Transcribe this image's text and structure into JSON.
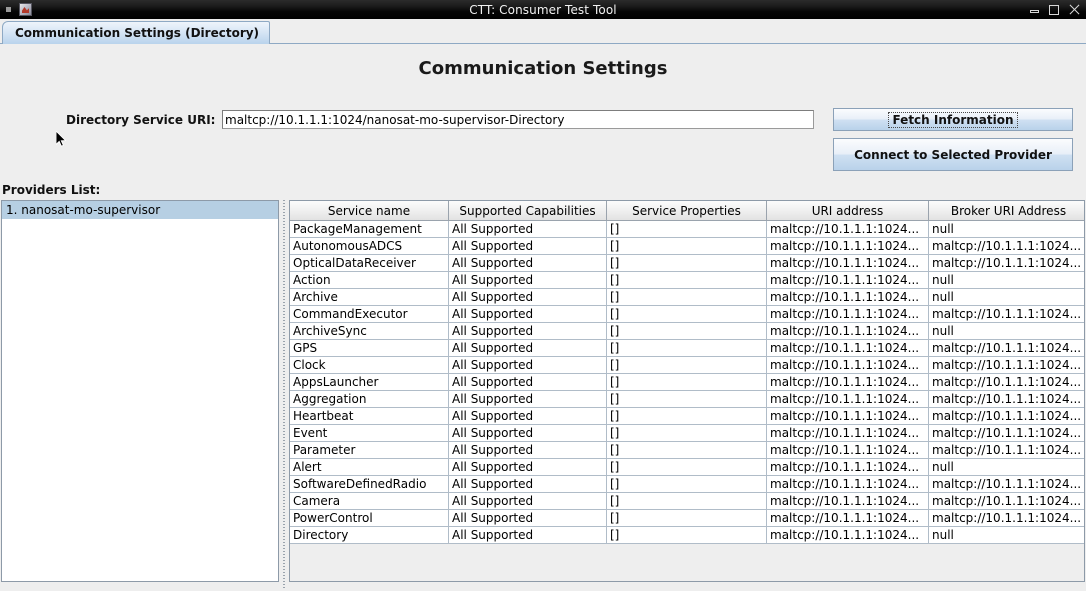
{
  "window": {
    "title": "CTT: Consumer Test Tool",
    "app_icon": "app-image-icon",
    "minimize_label": "Minimize",
    "maximize_label": "Maximize",
    "close_label": "Close"
  },
  "tabs": [
    {
      "label": "Communication Settings (Directory)",
      "selected": true
    }
  ],
  "main": {
    "page_title": "Communication Settings",
    "uri_label": "Directory Service URI:",
    "uri_value": "maltcp://10.1.1.1:1024/nanosat-mo-supervisor-Directory",
    "uri_placeholder": "",
    "fetch_button": "Fetch Information",
    "connect_button": "Connect to Selected Provider",
    "providers_label": "Providers List:"
  },
  "providers": [
    {
      "label": "1. nanosat-mo-supervisor",
      "selected": true
    }
  ],
  "table": {
    "columns": [
      "Service name",
      "Supported Capabilities",
      "Service Properties",
      "URI address",
      "Broker URI Address"
    ],
    "rows": [
      [
        "PackageManagement",
        "All Supported",
        "[]",
        "maltcp://10.1.1.1:1024...",
        "null"
      ],
      [
        "AutonomousADCS",
        "All Supported",
        "[]",
        "maltcp://10.1.1.1:1024...",
        "maltcp://10.1.1.1:1024..."
      ],
      [
        "OpticalDataReceiver",
        "All Supported",
        "[]",
        "maltcp://10.1.1.1:1024...",
        "maltcp://10.1.1.1:1024..."
      ],
      [
        "Action",
        "All Supported",
        "[]",
        "maltcp://10.1.1.1:1024...",
        "null"
      ],
      [
        "Archive",
        "All Supported",
        "[]",
        "maltcp://10.1.1.1:1024...",
        "null"
      ],
      [
        "CommandExecutor",
        "All Supported",
        "[]",
        "maltcp://10.1.1.1:1024...",
        "maltcp://10.1.1.1:1024..."
      ],
      [
        "ArchiveSync",
        "All Supported",
        "[]",
        "maltcp://10.1.1.1:1024...",
        "null"
      ],
      [
        "GPS",
        "All Supported",
        "[]",
        "maltcp://10.1.1.1:1024...",
        "maltcp://10.1.1.1:1024..."
      ],
      [
        "Clock",
        "All Supported",
        "[]",
        "maltcp://10.1.1.1:1024...",
        "maltcp://10.1.1.1:1024..."
      ],
      [
        "AppsLauncher",
        "All Supported",
        "[]",
        "maltcp://10.1.1.1:1024...",
        "maltcp://10.1.1.1:1024..."
      ],
      [
        "Aggregation",
        "All Supported",
        "[]",
        "maltcp://10.1.1.1:1024...",
        "maltcp://10.1.1.1:1024..."
      ],
      [
        "Heartbeat",
        "All Supported",
        "[]",
        "maltcp://10.1.1.1:1024...",
        "maltcp://10.1.1.1:1024..."
      ],
      [
        "Event",
        "All Supported",
        "[]",
        "maltcp://10.1.1.1:1024...",
        "maltcp://10.1.1.1:1024..."
      ],
      [
        "Parameter",
        "All Supported",
        "[]",
        "maltcp://10.1.1.1:1024...",
        "maltcp://10.1.1.1:1024..."
      ],
      [
        "Alert",
        "All Supported",
        "[]",
        "maltcp://10.1.1.1:1024...",
        "null"
      ],
      [
        "SoftwareDefinedRadio",
        "All Supported",
        "[]",
        "maltcp://10.1.1.1:1024...",
        "maltcp://10.1.1.1:1024..."
      ],
      [
        "Camera",
        "All Supported",
        "[]",
        "maltcp://10.1.1.1:1024...",
        "maltcp://10.1.1.1:1024..."
      ],
      [
        "PowerControl",
        "All Supported",
        "[]",
        "maltcp://10.1.1.1:1024...",
        "maltcp://10.1.1.1:1024..."
      ],
      [
        "Directory",
        "All Supported",
        "[]",
        "maltcp://10.1.1.1:1024...",
        "null"
      ]
    ]
  },
  "colors": {
    "titlebar": "#000000",
    "background": "#eeeeee",
    "tab_selected": "#b9d3ec",
    "selection": "#b6cfe3",
    "button": "#cfe0f2",
    "border": "#8d9aa8"
  }
}
